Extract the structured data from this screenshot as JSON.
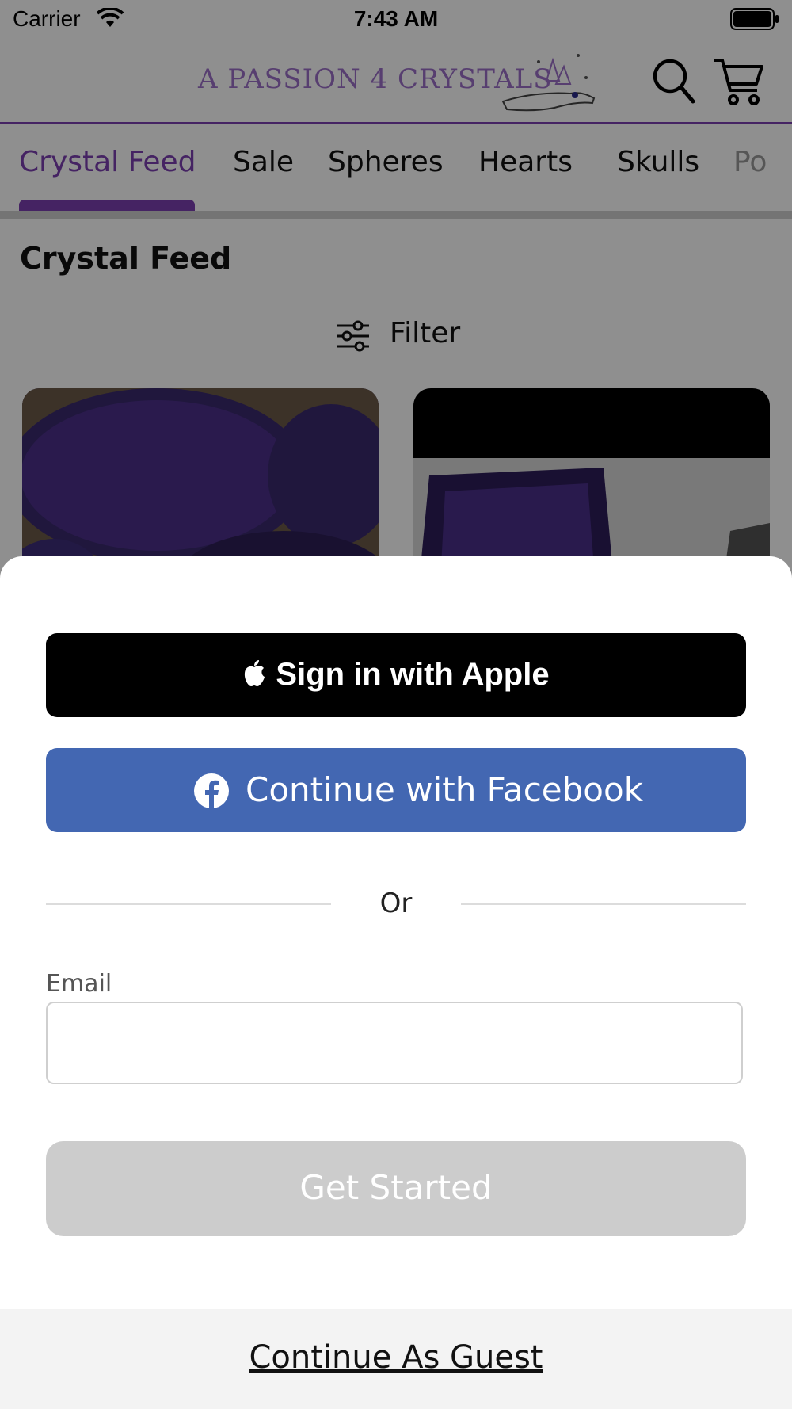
{
  "status_bar": {
    "carrier": "Carrier",
    "time": "7:43 AM"
  },
  "header": {
    "logo_text": "A PASSION 4 CRYSTALS"
  },
  "tabs": [
    {
      "label": "Crystal Feed",
      "active": true
    },
    {
      "label": "Sale",
      "active": false
    },
    {
      "label": "Spheres",
      "active": false
    },
    {
      "label": "Hearts",
      "active": false
    },
    {
      "label": "Skulls",
      "active": false
    },
    {
      "label": "Po",
      "active": false
    }
  ],
  "page": {
    "title": "Crystal Feed",
    "filter_label": "Filter"
  },
  "sheet": {
    "apple_label": "Sign in with Apple",
    "facebook_label": "Continue with Facebook",
    "or_text": "Or",
    "email_label": "Email",
    "email_value": "",
    "get_started_label": "Get Started",
    "guest_label": "Continue As Guest"
  },
  "colors": {
    "accent": "#7b3fb0",
    "facebook": "#4367b2",
    "apple": "#000000",
    "disabled": "#cccccc"
  }
}
